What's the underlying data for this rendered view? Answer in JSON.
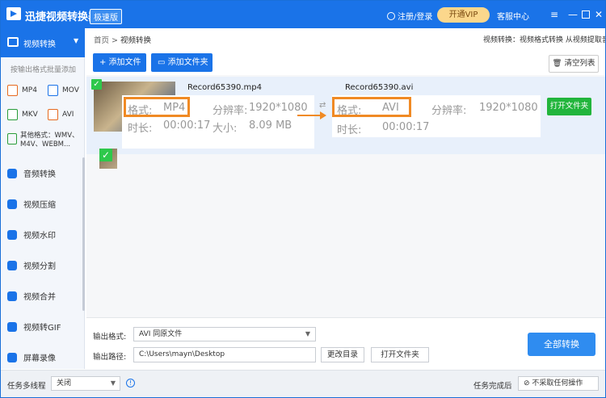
{
  "app": {
    "title": "迅捷视频转换器",
    "edition": "极速版",
    "login": "注册/登录",
    "vip": "开通VIP",
    "service": "客服中心",
    "menu_icon": "≡",
    "min_icon": "—",
    "close_icon": "✕"
  },
  "sidebar": {
    "active": "视频转换",
    "format_hint": "按输出格式批量添加",
    "formats": [
      "MP4",
      "MOV",
      "MKV",
      "AVI"
    ],
    "other_formats": "其他格式：WMV、M4V、WEBM...",
    "items": [
      "音频转换",
      "视频压缩",
      "视频水印",
      "视频分割",
      "视频合并",
      "视频转GIF",
      "屏幕录像"
    ]
  },
  "header": {
    "breadcrumb_home": "首页",
    "breadcrumb_sep": ">",
    "breadcrumb_current": "视频转换",
    "tip": "视频转换：视频格式转换 从视频提取音频"
  },
  "toolbar": {
    "add_file": "+ 添加文件",
    "add_folder": "添加文件夹",
    "clear_list": "清空列表"
  },
  "file": {
    "source_name": "Record65390.mp4",
    "target_name": "Record65390.avi",
    "format_label": "格式:",
    "resolution_label": "分辨率:",
    "duration_label": "时长:",
    "size_label": "大小:",
    "source_format": "MP4",
    "target_format": "AVI",
    "resolution": "1920*1080",
    "duration": "00:00:17",
    "size": "8.09 MB",
    "open_folder": "打开文件夹",
    "check": "✓"
  },
  "bottom": {
    "output_format_label": "输出格式:",
    "output_format_value": "AVI  同原文件",
    "output_path_label": "输出路径:",
    "output_path_value": "C:\\Users\\mayn\\Desktop",
    "change_dir": "更改目录",
    "open_folder": "打开文件夹",
    "convert_all": "全部转换"
  },
  "statusbar": {
    "multithread_label": "任务多线程",
    "multithread_value": "关闭",
    "after_task_label": "任务完成后",
    "after_task_value": "不采取任何操作"
  }
}
